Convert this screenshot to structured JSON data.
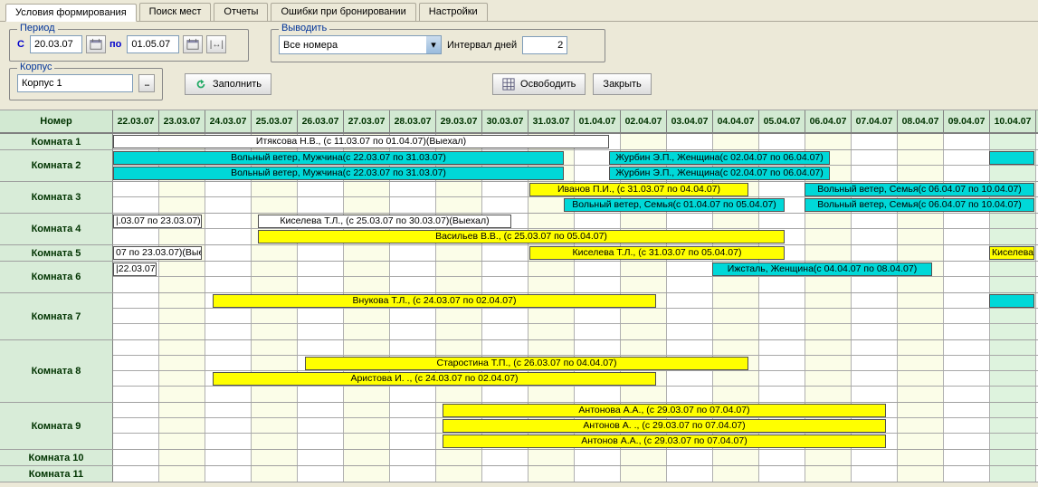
{
  "tabs": {
    "t0": "Условия формирования",
    "t1": "Поиск мест",
    "t2": "Отчеты",
    "t3": "Ошибки при бронировании",
    "t4": "Настройки"
  },
  "period": {
    "legend": "Период",
    "from_label": "С",
    "from_value": "20.03.07",
    "to_label": "по",
    "to_value": "01.05.07"
  },
  "korpus": {
    "legend": "Корпус",
    "value": "Корпус 1"
  },
  "output": {
    "legend": "Выводить",
    "dropdown_value": "Все номера",
    "interval_label": "Интервал дней",
    "interval_value": "2"
  },
  "buttons": {
    "fill": "Заполнить",
    "free": "Освободить",
    "close": "Закрыть"
  },
  "grid": {
    "header_room": "Номер",
    "dates": [
      "22.03.07",
      "23.03.07",
      "24.03.07",
      "25.03.07",
      "26.03.07",
      "27.03.07",
      "28.03.07",
      "29.03.07",
      "30.03.07",
      "31.03.07",
      "01.04.07",
      "02.04.07",
      "03.04.07",
      "04.04.07",
      "05.04.07",
      "06.04.07",
      "07.04.07",
      "08.04.07",
      "09.04.07",
      "10.04.07"
    ],
    "rooms": {
      "r1": "Комната 1",
      "r2": "Комната 2",
      "r3": "Комната 3",
      "r4": "Комната 4",
      "r5": "Комната 5",
      "r6": "Комната 6",
      "r7": "Комната 7",
      "r8": "Комната 8",
      "r9": "Комната 9",
      "r10": "Комната 10",
      "r11": "Комната 11"
    },
    "bars": {
      "b1": "Итяксова Н.В., (с 11.03.07 по 01.04.07)(Выехал)",
      "b2": "Вольный ветер, Мужчина(с 22.03.07 по 31.03.07)",
      "b3": "Вольный ветер, Мужчина(с 22.03.07 по 31.03.07)",
      "b4": "Журбин Э.П., Женщина(с 02.04.07 по 06.04.07)",
      "b5": "Журбин Э.П., Женщина(с 02.04.07 по 06.04.07)",
      "b6": "Иванов П.И., (с 31.03.07 по 04.04.07)",
      "b7": "Вольный ветер, Семья(с 06.04.07 по 10.04.07)",
      "b8": "Вольный ветер, Семья(с 01.04.07 по 05.04.07)",
      "b9": "Вольный ветер, Семья(с 06.04.07 по 10.04.07)",
      "b10": "|.03.07 по 23.03.07)(",
      "b11": "Киселева Т.Л., (с 25.03.07 по 30.03.07)(Выехал)",
      "b12": "Васильев В.В., (с 25.03.07 по 05.04.07)",
      "b13": "07 по 23.03.07)(Вые",
      "b14": "Киселева Т.Л., (с 31.03.07 по 05.04.07)",
      "b15": "Киселева",
      "b16": "|22.03.07)(",
      "b17": "Ижсталь, Женщина(с 04.04.07 по 08.04.07)",
      "b18": "Внукова Т.Л., (с 24.03.07 по 02.04.07)",
      "b19": "Старостина Т.П., (с 26.03.07 по 04.04.07)",
      "b20": "Аристова И. ., (с 24.03.07 по 02.04.07)",
      "b21": "Антонова А.А., (с 29.03.07 по 07.04.07)",
      "b22": "Антонов А. ., (с 29.03.07 по 07.04.07)",
      "b23": "Антонов А.А., (с 29.03.07 по 07.04.07)"
    }
  }
}
